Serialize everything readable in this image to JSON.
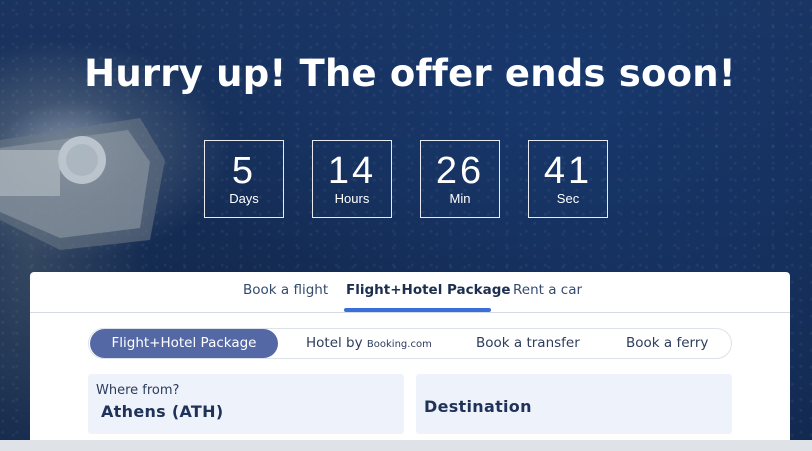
{
  "hero": {
    "headline": "Hurry up! The offer ends soon!"
  },
  "countdown": [
    {
      "value": "5",
      "label": "Days"
    },
    {
      "value": "14",
      "label": "Hours"
    },
    {
      "value": "26",
      "label": "Min"
    },
    {
      "value": "41",
      "label": "Sec"
    }
  ],
  "tabs": {
    "items": [
      {
        "label": "Book a flight"
      },
      {
        "label": "Flight+Hotel Package"
      },
      {
        "label": "Rent a car"
      }
    ],
    "active": "Flight+Hotel Package"
  },
  "subtabs": {
    "items": [
      {
        "label": "Flight+Hotel Package"
      },
      {
        "label": "Hotel by",
        "suffix": "Booking.com"
      },
      {
        "label": "Book a transfer"
      },
      {
        "label": "Book a ferry"
      }
    ]
  },
  "fields": {
    "from_label": "Where from?",
    "from_value": "Athens (ATH)",
    "destination_placeholder": "Destination"
  },
  "colors": {
    "accent": "#3a6fd8",
    "active_pill": "#5468a6",
    "field_bg": "#eef2fa",
    "hero_bg": "#142b52"
  }
}
